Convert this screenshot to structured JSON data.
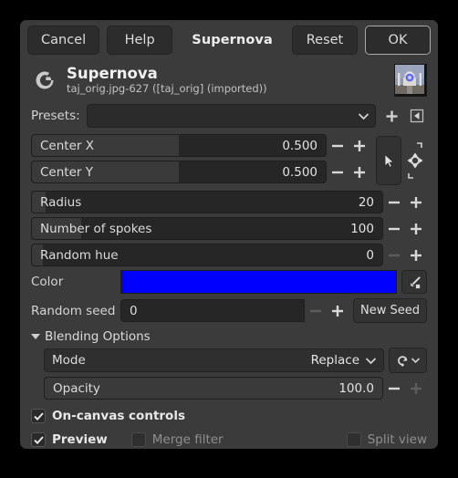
{
  "window": {
    "actions": {
      "cancel": "Cancel",
      "help": "Help",
      "title": "Supernova",
      "reset": "Reset",
      "ok": "OK"
    }
  },
  "filter_header": {
    "logo_icon": "gimp-g-logo-icon",
    "name": "Supernova",
    "source": "taj_orig.jpg-627 ([taj_orig] (imported))",
    "thumbnail_icon": "taj-mahal-thumbnail"
  },
  "presets": {
    "label": "Presets:",
    "value": "",
    "add_icon": "plus-icon",
    "menu_icon": "preset-menu-icon"
  },
  "parameters": [
    {
      "label": "Center X",
      "value": "0.500",
      "fill_pct": 50,
      "minus_enabled": true,
      "plus_enabled": true
    },
    {
      "label": "Center Y",
      "value": "0.500",
      "fill_pct": 50,
      "minus_enabled": true,
      "plus_enabled": true
    },
    {
      "label": "Radius",
      "value": "20",
      "fill_pct": 4,
      "minus_enabled": true,
      "plus_enabled": true
    },
    {
      "label": "Number of spokes",
      "value": "100",
      "fill_pct": 14,
      "minus_enabled": true,
      "plus_enabled": true
    },
    {
      "label": "Random hue",
      "value": "0",
      "fill_pct": 3,
      "minus_enabled": false,
      "plus_enabled": true
    }
  ],
  "center_tools": {
    "pointer_icon": "pointer-cursor-icon",
    "pick_icon": "pick-coordinates-icon"
  },
  "color": {
    "label": "Color",
    "value": "#0000FF",
    "pipette_icon": "eyedropper-icon"
  },
  "random_seed": {
    "label": "Random seed",
    "value": "0",
    "minus_enabled": false,
    "plus_enabled": true,
    "new_seed_label": "New Seed"
  },
  "blending": {
    "section_label": "Blending Options",
    "expanded": true,
    "mode": {
      "label": "Mode",
      "value": "Replace",
      "reset_icon": "reset-arrow-icon",
      "chevron_icon": "chevron-down-icon"
    },
    "opacity": {
      "label": "Opacity",
      "value": "100.0",
      "fill_pct": 100,
      "minus_enabled": true,
      "plus_enabled": false
    }
  },
  "options": {
    "on_canvas_controls": {
      "label": "On-canvas controls",
      "checked": true
    },
    "preview": {
      "label": "Preview",
      "checked": true
    },
    "merge_filter": {
      "label": "Merge filter",
      "checked": false
    },
    "split_view": {
      "label": "Split view",
      "checked": false
    }
  }
}
